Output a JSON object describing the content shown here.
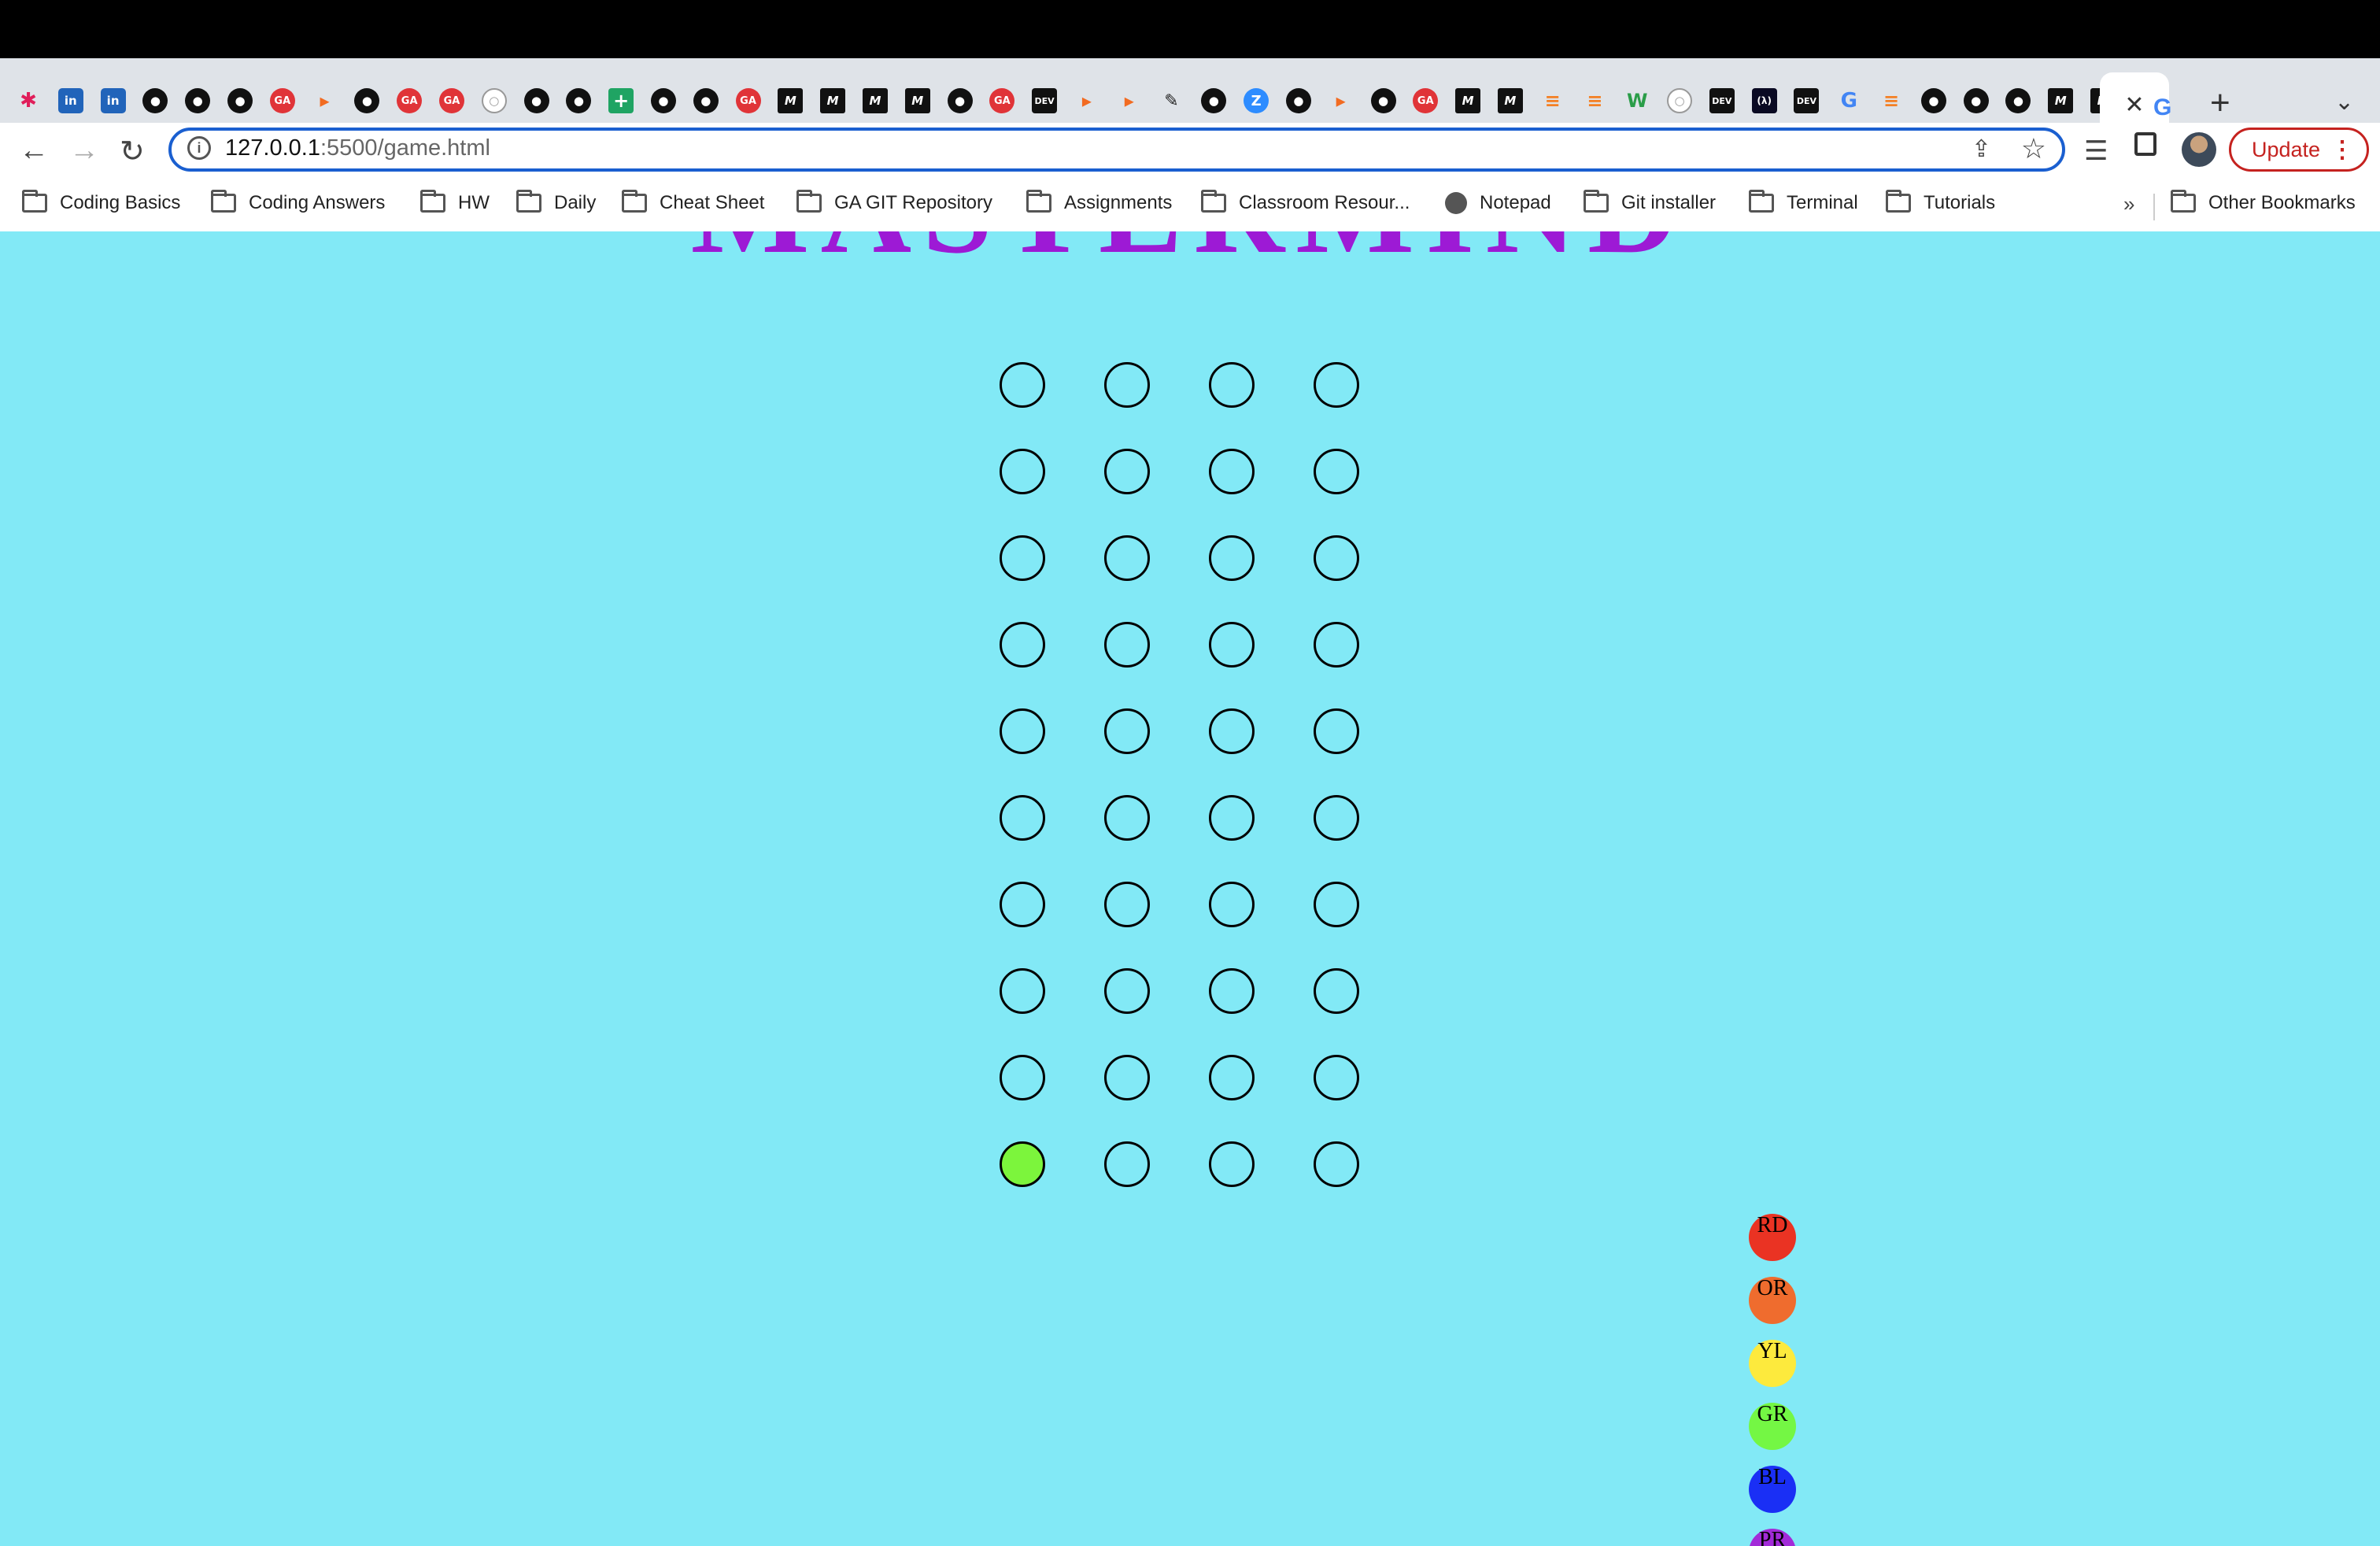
{
  "browser": {
    "tab_favicons": [
      "slack",
      "linkedin",
      "linkedin",
      "github",
      "github",
      "github",
      "ga",
      "abstract",
      "github",
      "ga",
      "ga",
      "github-light",
      "github",
      "github",
      "sheets",
      "github",
      "github",
      "ga",
      "medium",
      "medium",
      "medium",
      "medium",
      "github",
      "ga",
      "dev",
      "abstract",
      "abstract",
      "excalidraw",
      "github",
      "zoom",
      "github",
      "abstract",
      "github",
      "ga",
      "medium",
      "medium",
      "stackoverflow",
      "stackoverflow",
      "webflow",
      "github-light",
      "dev",
      "freecodecamp",
      "dev",
      "google",
      "stackoverflow",
      "github",
      "github",
      "github",
      "medium",
      "medium"
    ],
    "tab_labels": {
      "linkedin": "in",
      "github": "●",
      "ga": "GA",
      "medium": "M",
      "dev": "DEV",
      "abstract": "▸",
      "stackoverflow": "≡",
      "google": "G",
      "slack": "✱",
      "sheets": "+",
      "webflow": "W",
      "zoom": "Z",
      "excalidraw": "✎",
      "freecodecamp": "(λ)",
      "github-light": "○"
    },
    "active_tab_close": "✕",
    "new_tab": "+",
    "tab_search": "⌄",
    "back": "←",
    "forward": "→",
    "reload": "↻",
    "url_host": "127.0.0.1",
    "url_rest": ":5500/game.html",
    "update_label": "Update",
    "bookmarks": [
      {
        "label": "Coding Basics",
        "icon": "folder-icon"
      },
      {
        "label": "Coding Answers",
        "icon": "folder-icon"
      },
      {
        "label": "HW",
        "icon": "folder-icon"
      },
      {
        "label": "Daily",
        "icon": "folder-icon"
      },
      {
        "label": "Cheat Sheet",
        "icon": "folder-icon"
      },
      {
        "label": "GA GIT Repository",
        "icon": "folder-icon"
      },
      {
        "label": "Assignments",
        "icon": "folder-icon"
      },
      {
        "label": "Classroom Resour...",
        "icon": "folder-icon"
      },
      {
        "label": "Notepad",
        "icon": "globe-icon"
      },
      {
        "label": "Git installer",
        "icon": "folder-icon"
      },
      {
        "label": "Terminal",
        "icon": "folder-icon"
      },
      {
        "label": "Tutorials",
        "icon": "folder-icon"
      }
    ],
    "bookmarks_overflow": "»",
    "other_bookmarks": "Other Bookmarks"
  },
  "game": {
    "title": "MASTERMIND",
    "rows": 10,
    "columns": 4,
    "filled_pegs": [
      {
        "row": 9,
        "col": 0,
        "color": "#7cf53c"
      }
    ],
    "palette": [
      {
        "label": "RD",
        "color": "#ea3323"
      },
      {
        "label": "OR",
        "color": "#ef6c2e"
      },
      {
        "label": "YL",
        "color": "#fdea3d"
      },
      {
        "label": "GR",
        "color": "#74f744"
      },
      {
        "label": "BL",
        "color": "#1a2ff5"
      },
      {
        "label": "PR",
        "color": "#a22bd8"
      }
    ],
    "background_color": "#82e9f6",
    "title_color": "#9d1ad5"
  }
}
